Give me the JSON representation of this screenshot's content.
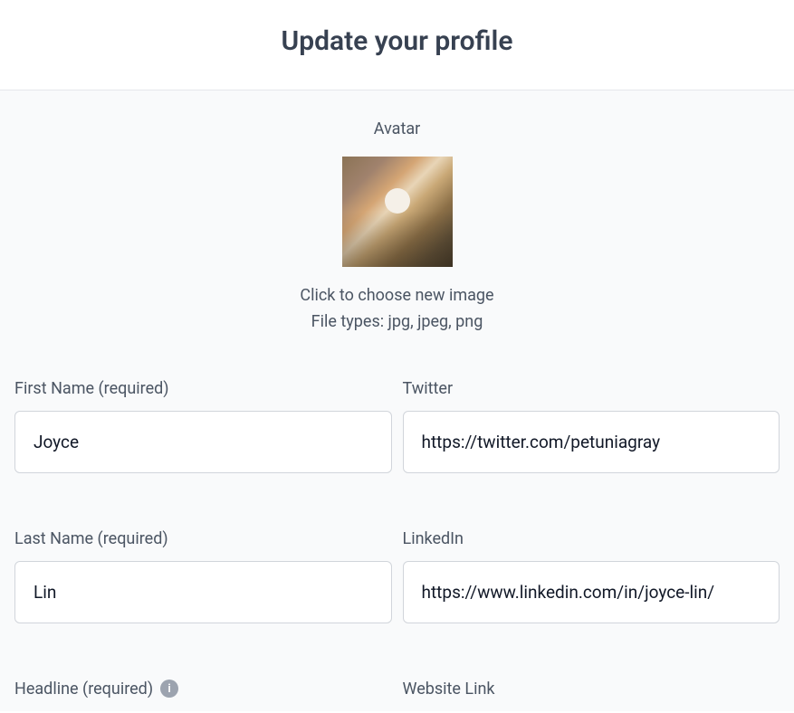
{
  "header": {
    "title": "Update your profile"
  },
  "avatar": {
    "label": "Avatar",
    "hint_line1": "Click to choose new image",
    "hint_line2": "File types: jpg, jpeg, png"
  },
  "fields": {
    "first_name": {
      "label": "First Name (required)",
      "value": "Joyce"
    },
    "twitter": {
      "label": "Twitter",
      "value": "https://twitter.com/petuniagray"
    },
    "last_name": {
      "label": "Last Name (required)",
      "value": "Lin"
    },
    "linkedin": {
      "label": "LinkedIn",
      "value": "https://www.linkedin.com/in/joyce-lin/"
    },
    "headline": {
      "label": "Headline (required)"
    },
    "website": {
      "label": "Website Link"
    }
  }
}
